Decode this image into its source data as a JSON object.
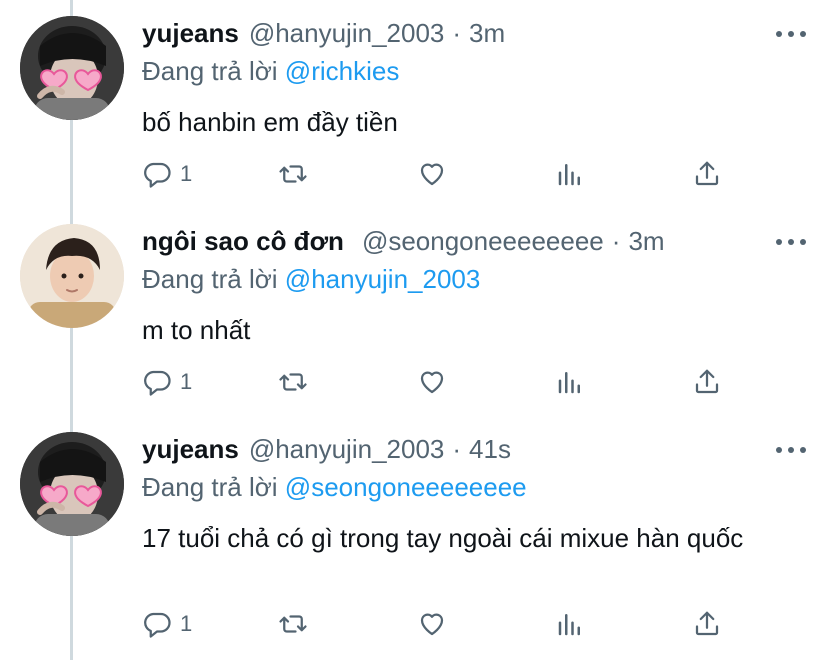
{
  "tweets": [
    {
      "name": "yujeans",
      "handle": "@hanyujin_2003",
      "separator": "·",
      "time": "3m",
      "reply_label": "Đang trả lời",
      "reply_mention": "@richkies",
      "text": "bố hanbin em đầy tiền",
      "reply_count": "1",
      "avatar": "user-avatar-heart-glasses"
    },
    {
      "name": "ngôi sao cô đơn",
      "handle": "@seongoneeeeeeee",
      "separator": "·",
      "time": "3m",
      "reply_label": "Đang trả lời",
      "reply_mention": "@hanyujin_2003",
      "text": "m to nhất",
      "reply_count": "1",
      "avatar": "user-avatar-portrait"
    },
    {
      "name": "yujeans",
      "handle": "@hanyujin_2003",
      "separator": "·",
      "time": "41s",
      "reply_label": "Đang trả lời",
      "reply_mention": "@seongoneeeeeeee",
      "text": "17 tuổi chả có gì trong tay ngoài cái mixue hàn quốc",
      "reply_count": "1",
      "avatar": "user-avatar-heart-glasses"
    }
  ],
  "icons": {
    "reply": "reply-icon",
    "retweet": "retweet-icon",
    "like": "heart-icon",
    "views": "views-icon",
    "share": "share-icon",
    "more": "more-icon"
  },
  "colors": {
    "text": "#0f1419",
    "muted": "#536471",
    "link": "#1d9bf0",
    "thread_line": "#cfd9de"
  }
}
